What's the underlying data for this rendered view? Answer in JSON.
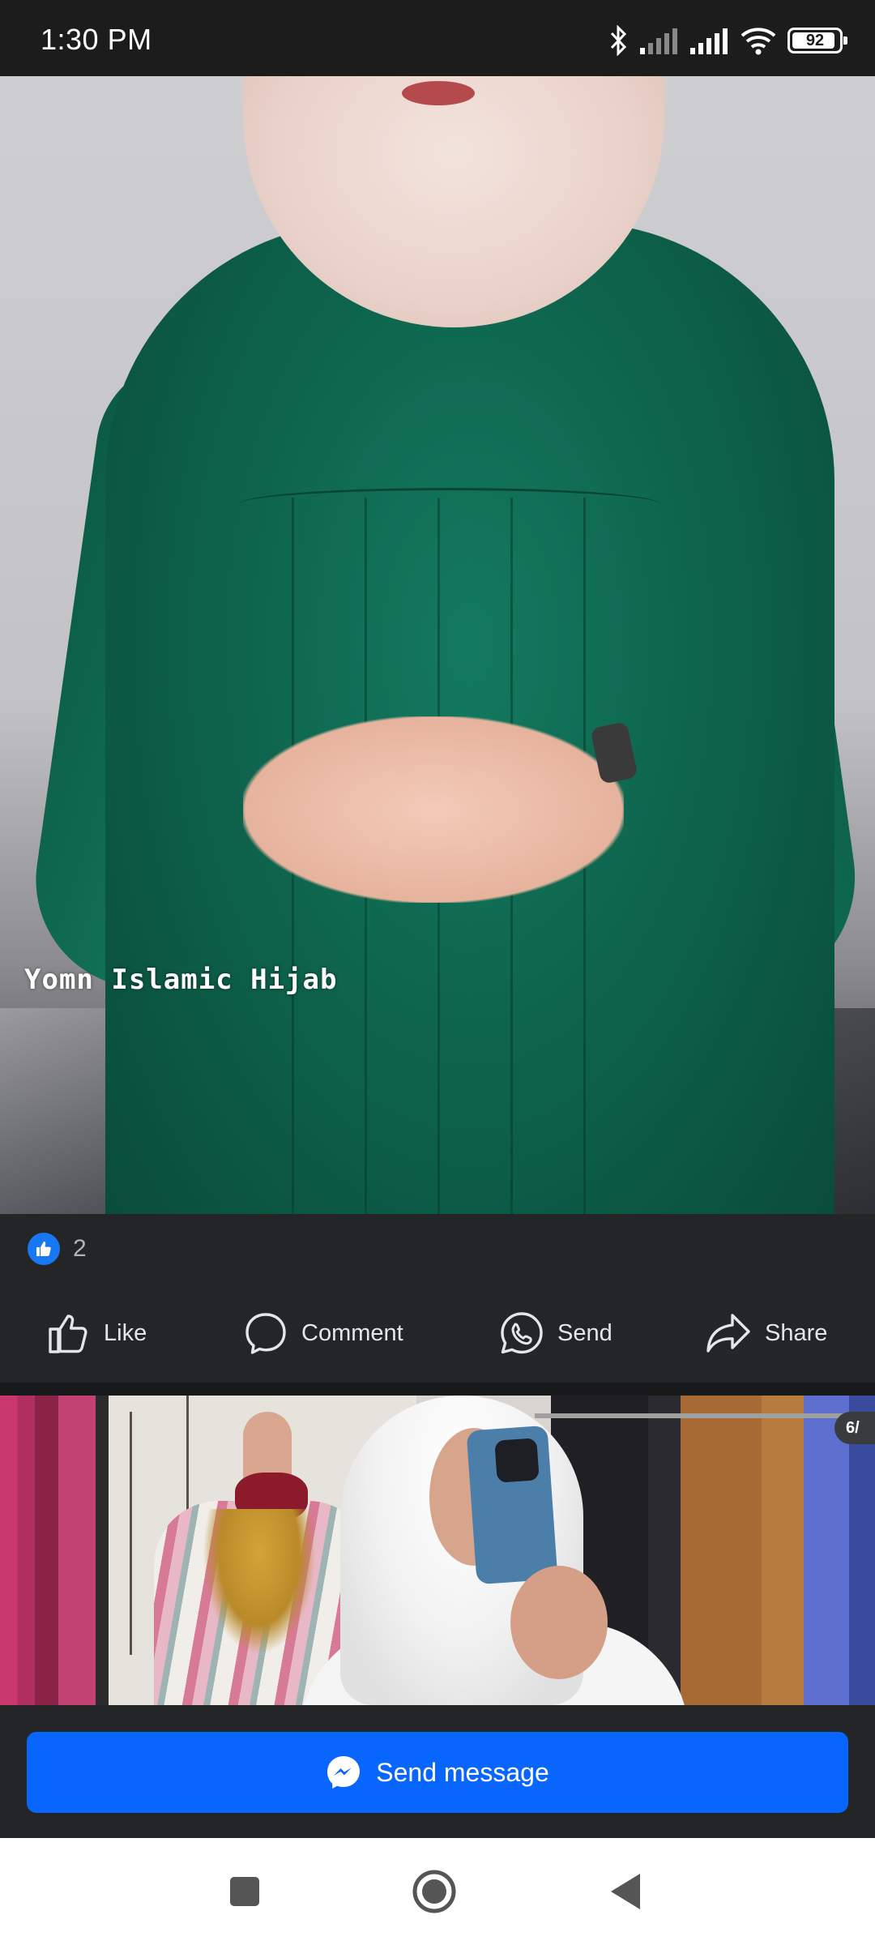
{
  "status_bar": {
    "time": "1:30 PM",
    "battery": "92",
    "battery_level": 0.92,
    "icons": [
      "bluetooth-icon",
      "signal-icon",
      "signal-icon",
      "wifi-icon",
      "battery-icon"
    ]
  },
  "post": {
    "watermark": "Yomn Islamic Hijab",
    "reaction_count": "2",
    "actions": {
      "like": "Like",
      "comment": "Comment",
      "send": "Send",
      "share": "Share"
    }
  },
  "next_post": {
    "photo_counter": "6/"
  },
  "cta": {
    "send_message": "Send message"
  },
  "colors": {
    "accent": "#0866ff",
    "surface": "#242526",
    "like_badge": "#1877f2"
  },
  "nav": {
    "icons": [
      "recents-icon",
      "home-icon",
      "back-icon"
    ]
  }
}
